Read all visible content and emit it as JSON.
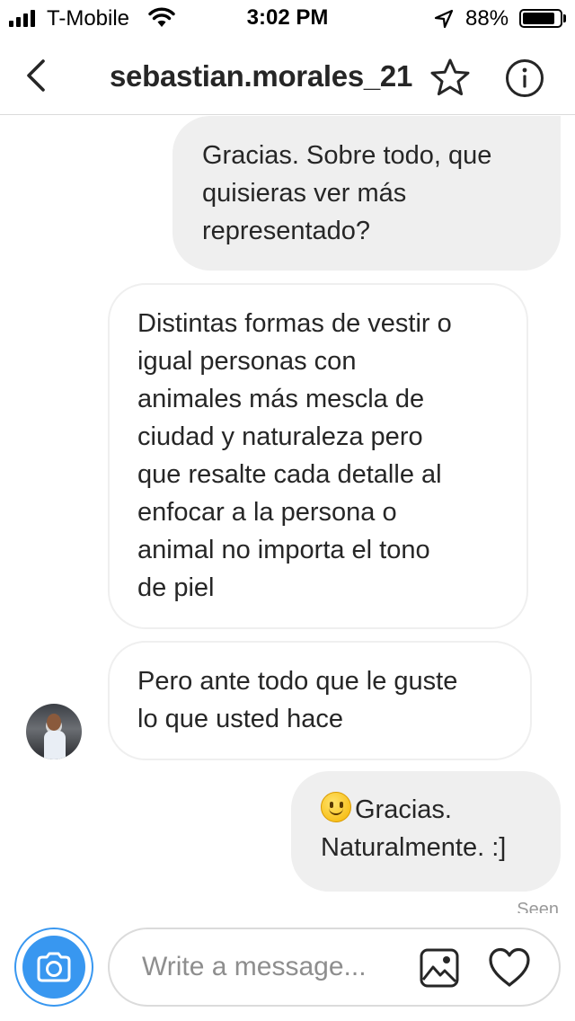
{
  "status_bar": {
    "carrier": "T-Mobile",
    "time": "3:02 PM",
    "battery_percent": "88%",
    "battery_level": 0.88,
    "icons": [
      "signal-icon",
      "wifi-icon",
      "location-arrow-icon",
      "battery-icon"
    ]
  },
  "header": {
    "title": "sebastian.morales_21",
    "icons": [
      "chevron-left-icon",
      "star-icon",
      "info-icon"
    ]
  },
  "messages": [
    {
      "direction": "outgoing",
      "text": "Gracias. Sobre todo, que\nquisieras ver más\nrepresentado?"
    },
    {
      "direction": "incoming",
      "text": "Distintas formas de vestir o\nigual personas con\nanimales más mescla de\nciudad y naturaleza pero\nque resalte cada detalle al\nenfocar a la persona o\nanimal no importa el tono\nde piel"
    },
    {
      "direction": "incoming",
      "text": "Pero ante todo que le guste\nlo que usted hace"
    },
    {
      "direction": "outgoing",
      "emoji": "slightly-smiling-face-emoji",
      "text": "Gracias.\nNaturalmente. :]"
    }
  ],
  "seen_label": "Seen",
  "composer": {
    "placeholder": "Write a message...",
    "accent_color": "#3897f0",
    "icons": [
      "camera-icon",
      "image-icon",
      "heart-icon"
    ]
  }
}
